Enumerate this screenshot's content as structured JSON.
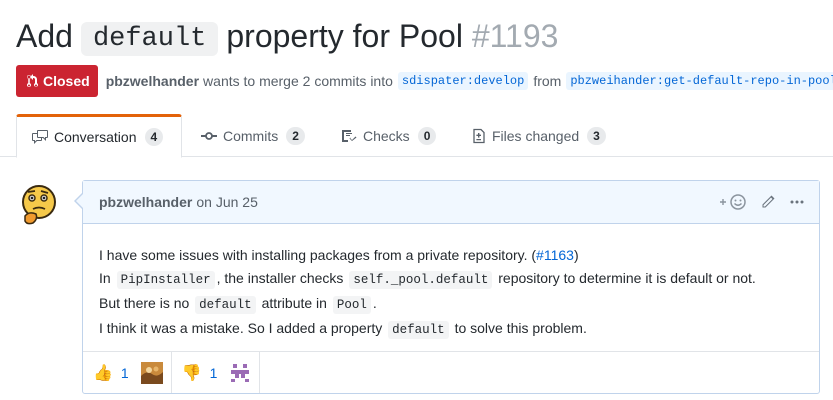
{
  "pr": {
    "title_prefix": "Add",
    "title_code": "default",
    "title_suffix": "property for Pool",
    "number": "#1193",
    "state": "Closed",
    "author": "pbzwelhander",
    "merge_text": "wants to merge 2 commits into",
    "base_branch": "sdispater:develop",
    "from_text": "from",
    "head_branch": "pbzweihander:get-default-repo-in-pool"
  },
  "tabs": [
    {
      "label": "Conversation",
      "count": "4",
      "icon": "comment-discussion-icon"
    },
    {
      "label": "Commits",
      "count": "2",
      "icon": "git-commit-icon"
    },
    {
      "label": "Checks",
      "count": "0",
      "icon": "checklist-icon"
    },
    {
      "label": "Files changed",
      "count": "3",
      "icon": "file-diff-icon"
    }
  ],
  "comment": {
    "author": "pbzwelhander",
    "date": "on Jun 25",
    "line1_text": "I have some issues with installing packages from a private repository. (",
    "line1_link": "#1163",
    "line1_end": ")",
    "line2_a": "In",
    "line2_code1": "PipInstaller",
    "line2_b": ", the installer checks",
    "line2_code2": "self._pool.default",
    "line2_c": "repository to determine it is default or not.",
    "line3_a": "But there is no",
    "line3_code1": "default",
    "line3_b": "attribute in",
    "line3_code2": "Pool",
    "line3_c": ".",
    "line4_a": "I think it was a mistake. So I added a property",
    "line4_code": "default",
    "line4_b": "to solve this problem."
  },
  "reactions": [
    {
      "emoji": "👍",
      "count": "1"
    },
    {
      "emoji": "👎",
      "count": "1"
    }
  ],
  "colors": {
    "closed": "#cb2431",
    "link": "#0366d6",
    "tab_accent": "#e36209",
    "comment_header": "#f1f8ff"
  }
}
